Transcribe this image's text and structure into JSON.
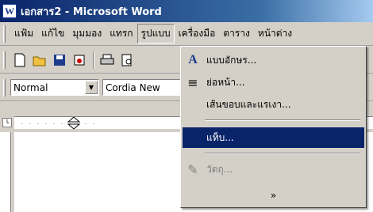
{
  "window": {
    "title": "เอกสาร2 - Microsoft Word",
    "app_icon": "word-icon"
  },
  "menubar": {
    "items": [
      "แฟ้ม",
      "แก้ไข",
      "มุมมอง",
      "แทรก",
      "รูปแบบ",
      "เครื่องมือ",
      "ตาราง",
      "หน้าต่าง"
    ],
    "active": "รูปแบบ"
  },
  "toolbar": {
    "icons": [
      "new-document-icon",
      "open-folder-icon",
      "save-icon",
      "permission-icon",
      "print-icon",
      "print-preview-icon"
    ]
  },
  "formatting": {
    "style": "Normal",
    "font": "Cordia New"
  },
  "dropdown": {
    "items": [
      {
        "label": "แบบอักษร...",
        "icon": "font-icon",
        "state": "normal"
      },
      {
        "label": "ย่อหน้า...",
        "icon": "paragraph-icon",
        "state": "normal"
      },
      {
        "label": "เส้นขอบและแรเงา...",
        "icon": "",
        "state": "normal"
      },
      {
        "label": "แท็บ...",
        "icon": "",
        "state": "highlighted"
      },
      {
        "label": "วัตถุ...",
        "icon": "object-icon",
        "state": "disabled"
      }
    ],
    "expand_glyph": "»"
  }
}
